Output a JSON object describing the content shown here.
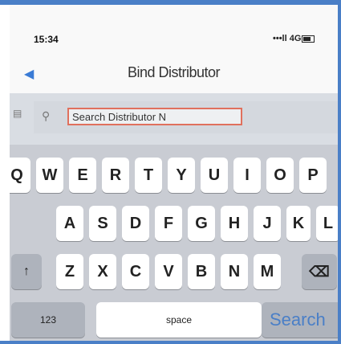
{
  "status": {
    "time": "15:34",
    "signal": "•••ll 4G"
  },
  "navbar": {
    "back_icon": "back-arrow-icon",
    "title": "Bind Distributor"
  },
  "search": {
    "value": "Search Distributor N"
  },
  "keyboard": {
    "row1": [
      "Q",
      "W",
      "E",
      "R",
      "T",
      "Y",
      "U",
      "I",
      "O",
      "P"
    ],
    "row2": [
      "A",
      "S",
      "D",
      "F",
      "G",
      "H",
      "J",
      "K",
      "L"
    ],
    "row3": [
      "Z",
      "X",
      "C",
      "V",
      "B",
      "N",
      "M"
    ],
    "shift": "↑",
    "delete": "⌫",
    "numbers_label": "123",
    "space_label": "space",
    "search_label": "Search"
  },
  "colors": {
    "frame": "#4a7fc7",
    "accent": "#3a7bd5",
    "input_border": "#e0705d"
  }
}
